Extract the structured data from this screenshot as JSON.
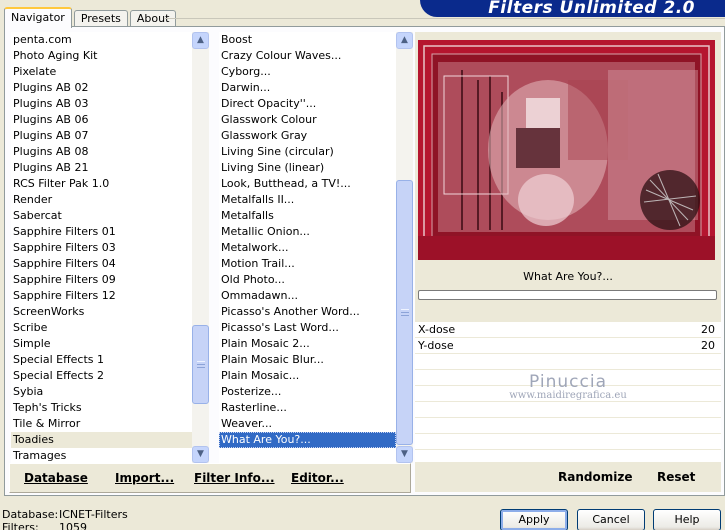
{
  "tabs": [
    {
      "label": "Navigator",
      "active": true
    },
    {
      "label": "Presets",
      "active": false
    },
    {
      "label": "About",
      "active": false
    }
  ],
  "app_title": "Filters Unlimited 2.0",
  "categories": [
    "penta.com",
    "Photo Aging Kit",
    "Pixelate",
    "Plugins AB 02",
    "Plugins AB 03",
    "Plugins AB 06",
    "Plugins AB 07",
    "Plugins AB 08",
    "Plugins AB 21",
    "RCS Filter Pak 1.0",
    "Render",
    "Sabercat",
    "Sapphire Filters 01",
    "Sapphire Filters 03",
    "Sapphire Filters 04",
    "Sapphire Filters 09",
    "Sapphire Filters 12",
    "ScreenWorks",
    "Scribe",
    "Simple",
    "Special Effects 1",
    "Special Effects 2",
    "Sybia",
    "Teph's Tricks",
    "Tile & Mirror",
    "Toadies",
    "Tramages"
  ],
  "selected_category": "Toadies",
  "filters": [
    "Boost",
    "Crazy Colour Waves...",
    "Cyborg...",
    "Darwin...",
    "Direct Opacity''...",
    "Glasswork Colour",
    "Glasswork Gray",
    "Living Sine (circular)",
    "Living Sine (linear)",
    "Look, Butthead, a TV!...",
    "Metalfalls II...",
    "Metalfalls",
    "Metallic Onion...",
    "Metalwork...",
    "Motion Trail...",
    "Old Photo...",
    "Ommadawn...",
    "Picasso's Another Word...",
    "Picasso's Last Word...",
    "Plain Mosaic 2...",
    "Plain Mosaic Blur...",
    "Plain Mosaic...",
    "Posterize...",
    "Rasterline...",
    "Weaver...",
    "What Are You?..."
  ],
  "selected_filter": "What Are You?...",
  "bottom_buttons": {
    "database": "Database",
    "import": "Import...",
    "filter_info": "Filter Info...",
    "editor": "Editor..."
  },
  "preview": {
    "filter_name": "What Are You?...",
    "progress": 0,
    "params": [
      {
        "name": "X-dose",
        "value": "20"
      },
      {
        "name": "Y-dose",
        "value": "20"
      }
    ],
    "randomize": "Randomize",
    "reset": "Reset",
    "watermark_name": "Pinuccia",
    "watermark_url": "www.maidiregrafica.eu"
  },
  "footer": {
    "database_label": "Database:",
    "database_value": "ICNET-Filters",
    "filters_label": "Filters:",
    "filters_value": "1059"
  },
  "dialog_buttons": {
    "apply": "Apply",
    "cancel": "Cancel",
    "help": "Help"
  },
  "colors": {
    "selection": "#316ac5",
    "preview_red": "#b5152f",
    "banner": "#0a2a8c"
  }
}
